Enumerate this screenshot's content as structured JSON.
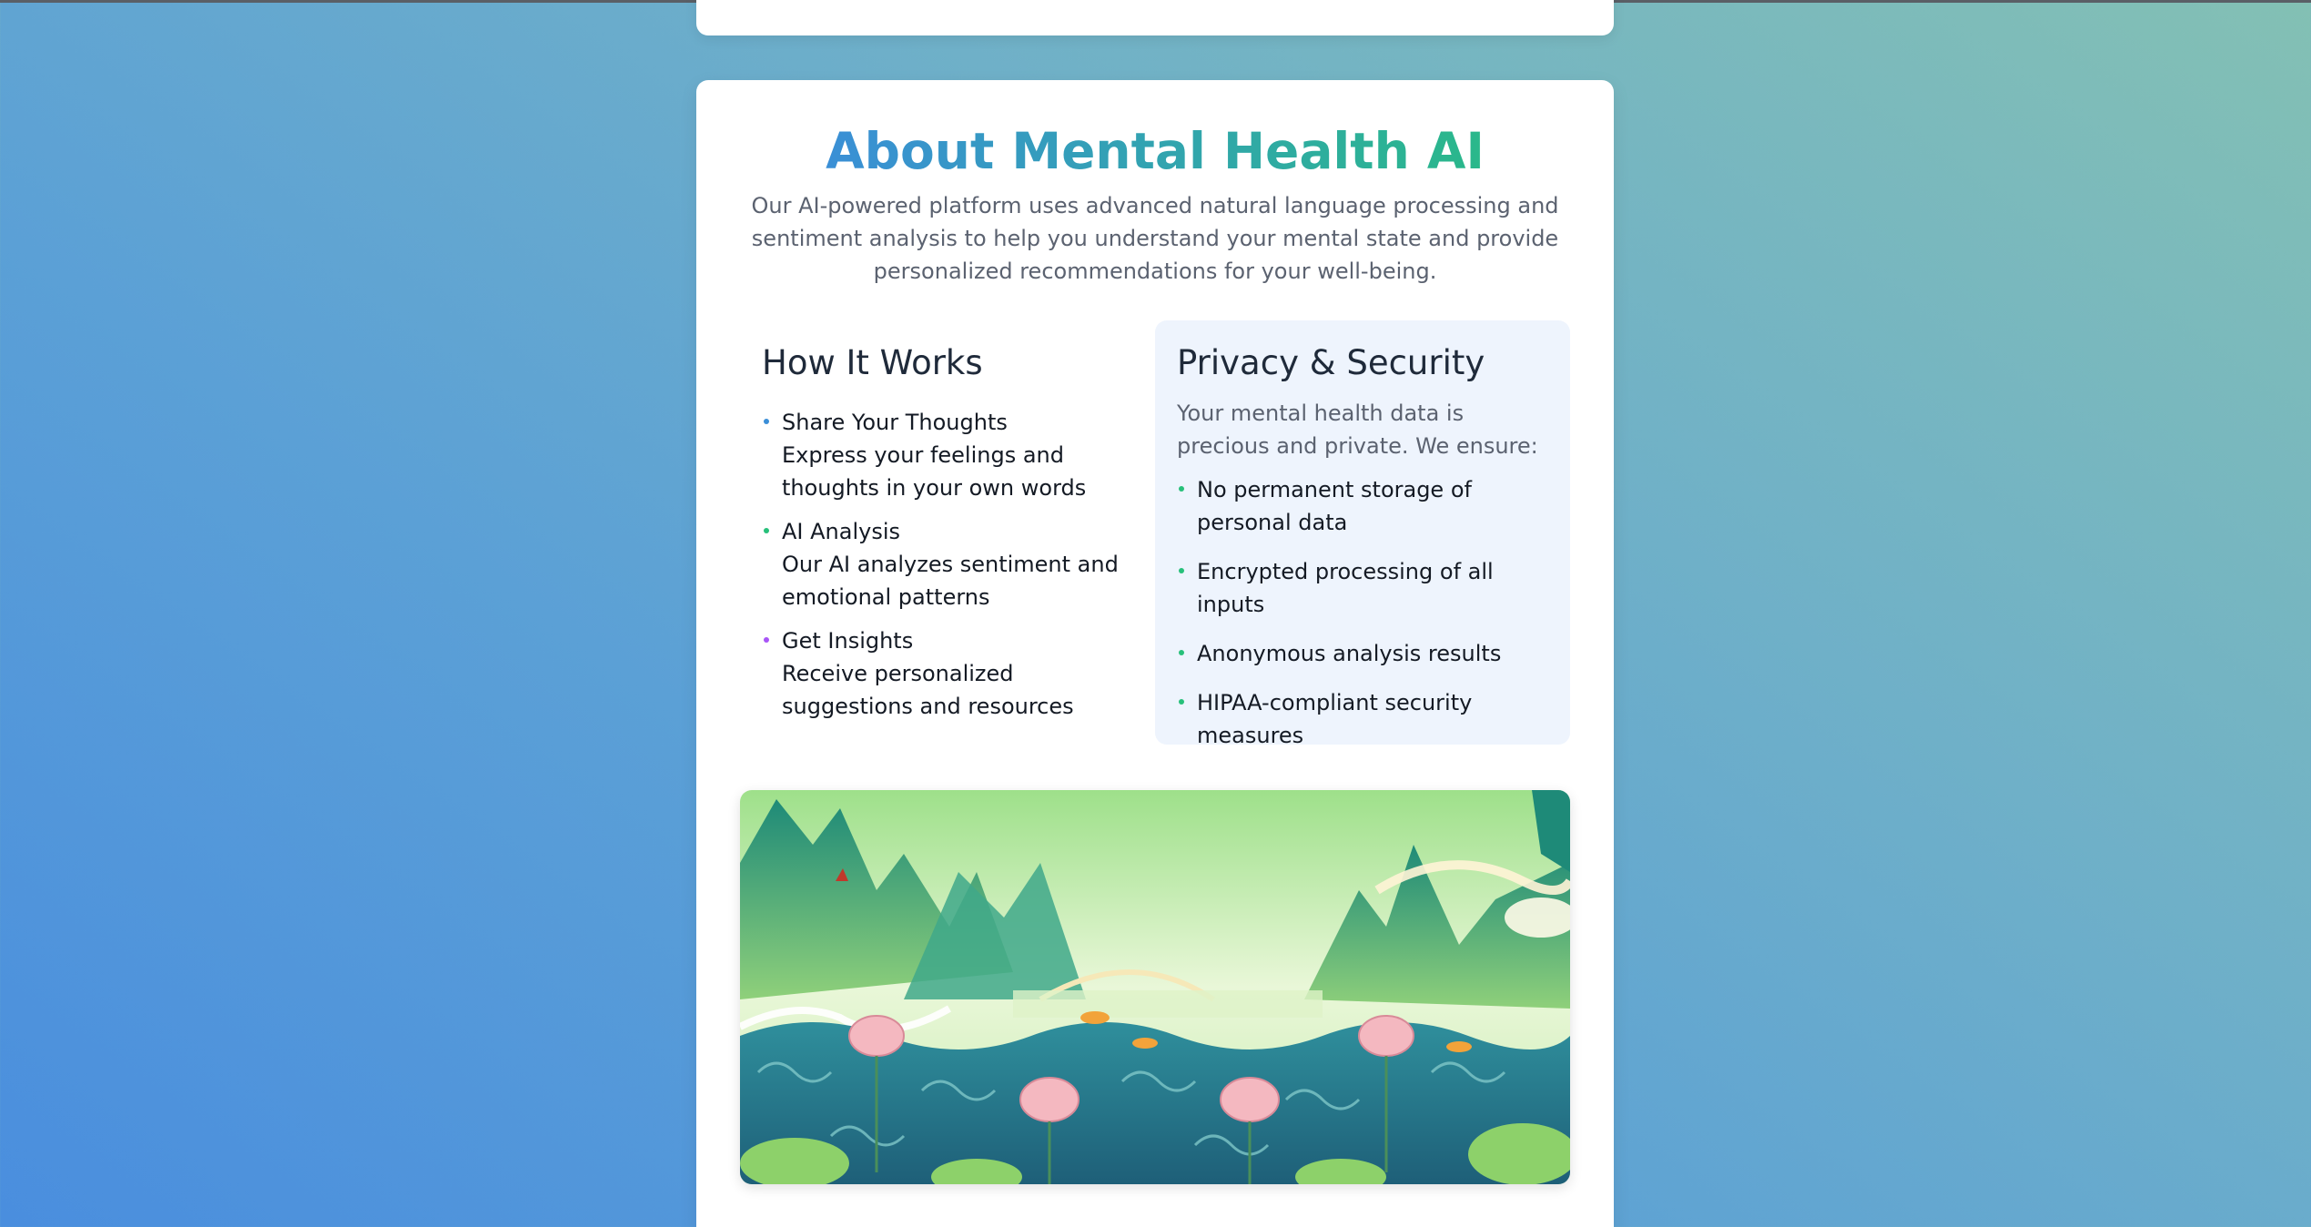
{
  "about": {
    "title": "About Mental Health AI",
    "intro": "Our AI-powered platform uses advanced natural language processing and sentiment analysis to help you understand your mental state and provide personalized recommendations for your well-being."
  },
  "how_it_works": {
    "heading": "How It Works",
    "steps": [
      {
        "title": "Share Your Thoughts",
        "desc": "Express your feelings and thoughts in your own words",
        "bullet_color": "#3b8fd8"
      },
      {
        "title": "AI Analysis",
        "desc": "Our AI analyzes sentiment and emotional patterns",
        "bullet_color": "#27c07a"
      },
      {
        "title": "Get Insights",
        "desc": "Receive personalized suggestions and resources",
        "bullet_color": "#a855f7"
      }
    ]
  },
  "privacy": {
    "heading": "Privacy & Security",
    "description": "Your mental health data is precious and private. We ensure:",
    "items": [
      "No permanent storage of personal data",
      "Encrypted processing of all inputs",
      "Anonymous analysis results",
      "HIPAA-compliant security measures"
    ],
    "bullet_color": "#27c07a"
  },
  "colors": {
    "title_gradient_start": "#3a8fd6",
    "title_gradient_end": "#2ab88a",
    "privacy_panel_bg": "#eef4fd"
  },
  "illustration": {
    "subject": "landscape-illustration"
  }
}
